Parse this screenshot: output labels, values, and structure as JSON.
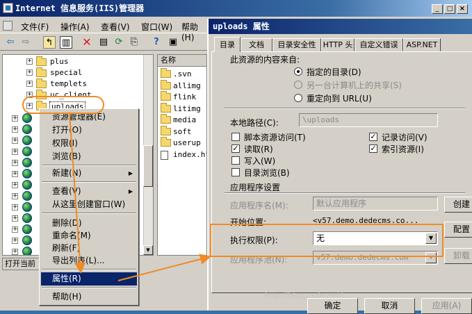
{
  "window": {
    "title": "Internet 信息服务(IIS)管理器"
  },
  "menu": [
    "文件(F)",
    "操作(A)",
    "查看(V)",
    "窗口(W)",
    "帮助(H)"
  ],
  "toolbar_icons": [
    "back-icon",
    "forward-icon",
    "up-icon",
    "show-tree-icon",
    "delete-icon",
    "properties-icon",
    "refresh-icon",
    "export-icon",
    "help-icon",
    "action-icon"
  ],
  "tree": {
    "folders": [
      "plus",
      "special",
      "templets",
      "uc_client",
      "uploads"
    ],
    "selected": "uploads"
  },
  "list": {
    "header": "名称",
    "items": [
      ".svn",
      "allimg",
      "flink",
      "litimg",
      "media",
      "soft",
      "userup",
      "index.ht"
    ]
  },
  "status": "打开当前",
  "context_menu": {
    "items": [
      "资源管理器(E)",
      "打开(O)",
      "权限(I)",
      "浏览(B)",
      "新建(N)",
      "查看(V)",
      "从这里创建窗口(W)",
      "删除(D)",
      "重命名(M)",
      "刷新(F)",
      "导出列表(L)...",
      "属性(R)",
      "帮助(H)"
    ],
    "selected": "属性(R)"
  },
  "dialog": {
    "title": "uploads 属性",
    "tabs": [
      "目录",
      "文档",
      "目录安全性",
      "HTTP 头",
      "自定义错误",
      "ASP.NET"
    ],
    "active_tab": "目录",
    "content_source_label": "此资源的内容来自:",
    "radios": [
      "指定的目录(D)",
      "另一台计算机上的共享(S)",
      "重定向到 URL(U)"
    ],
    "selected_radio": "指定的目录(D)",
    "local_path_label": "本地路径(C):",
    "local_path_value": "\\uploads",
    "checkboxes": {
      "script_access": {
        "label": "脚本资源访问(T)",
        "checked": false
      },
      "read": {
        "label": "读取(R)",
        "checked": true
      },
      "write": {
        "label": "写入(W)",
        "checked": false
      },
      "browse": {
        "label": "目录浏览(B)",
        "checked": false
      },
      "log_visits": {
        "label": "记录访问(V)",
        "checked": true
      },
      "index": {
        "label": "索引资源(I)",
        "checked": true
      }
    },
    "app_settings_label": "应用程序设置",
    "app_name_label": "应用程序名(M):",
    "app_name_value": "默认应用程序",
    "start_point_label": "开始位置:",
    "start_point_value": "<v57.demo.dedecms.co...",
    "exec_perm_label": "执行权限(P):",
    "exec_perm_value": "无",
    "app_pool_label": "应用程序池(N):",
    "app_pool_value": "v57.demo.dedecms.com",
    "side_buttons": [
      "创建",
      "配置",
      "卸载"
    ],
    "bottom_buttons": [
      "确定",
      "取消",
      "应用(A)"
    ],
    "watermark": "http://blog.csdn.net/..."
  },
  "annotation_color": "#f08a24"
}
